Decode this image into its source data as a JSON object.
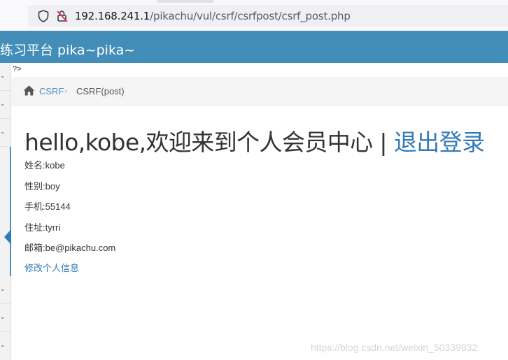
{
  "browser": {
    "url_host": "192.168.241.1",
    "url_path": "/pikachu/vul/csrf/csrfpost/csrf_post.php"
  },
  "header": {
    "site_title": "练习平台 pika~pika~"
  },
  "page": {
    "php_tag": "?>"
  },
  "breadcrumb": {
    "parent": "CSRF",
    "current": "CSRF(post)"
  },
  "main": {
    "greeting": "hello,kobe,欢迎来到个人会员中心",
    "separator": "|",
    "logout_label": "退出登录",
    "info": {
      "name": "姓名:kobe",
      "gender": "性别:boy",
      "phone": "手机:55144",
      "address": "住址:tyrri",
      "email": "邮箱:be@pikachu.com"
    },
    "edit_label": "修改个人信息"
  },
  "watermark": "https://blog.csdn.net/weixin_50339832",
  "colors": {
    "header_bg": "#438eb9",
    "link": "#337ab7",
    "breadcrumb_link": "#4c8fbd"
  },
  "icons": [
    "shield-icon",
    "lock-insecure-icon",
    "home-icon",
    "chevron-right-icon"
  ]
}
